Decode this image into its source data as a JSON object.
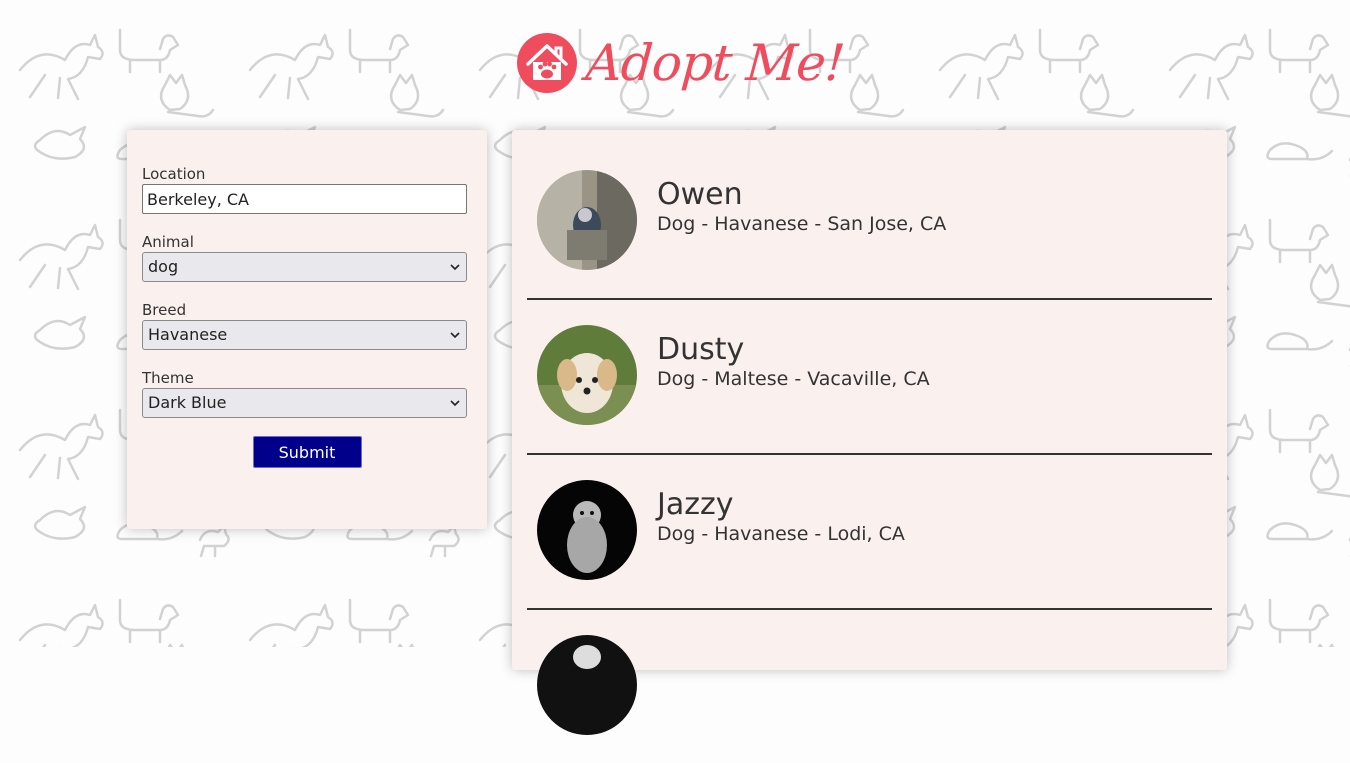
{
  "header": {
    "title": "Adopt Me!"
  },
  "form": {
    "location": {
      "label": "Location",
      "value": "Berkeley, CA"
    },
    "animal": {
      "label": "Animal",
      "value": "dog"
    },
    "breed": {
      "label": "Breed",
      "value": "Havanese"
    },
    "theme": {
      "label": "Theme",
      "value": "Dark Blue"
    },
    "submit_label": "Submit"
  },
  "pets": [
    {
      "name": "Owen",
      "description": "Dog - Havanese - San Jose, CA"
    },
    {
      "name": "Dusty",
      "description": "Dog - Maltese - Vacaville, CA"
    },
    {
      "name": "Jazzy",
      "description": "Dog - Havanese - Lodi, CA"
    },
    {
      "name": "",
      "description": ""
    }
  ],
  "colors": {
    "brand": "#ef4c5e",
    "submit": "#00008b",
    "panel": "#faf0ee"
  },
  "icons": {
    "logo": "house-paw-icon",
    "select": "chevron-down-icon"
  }
}
